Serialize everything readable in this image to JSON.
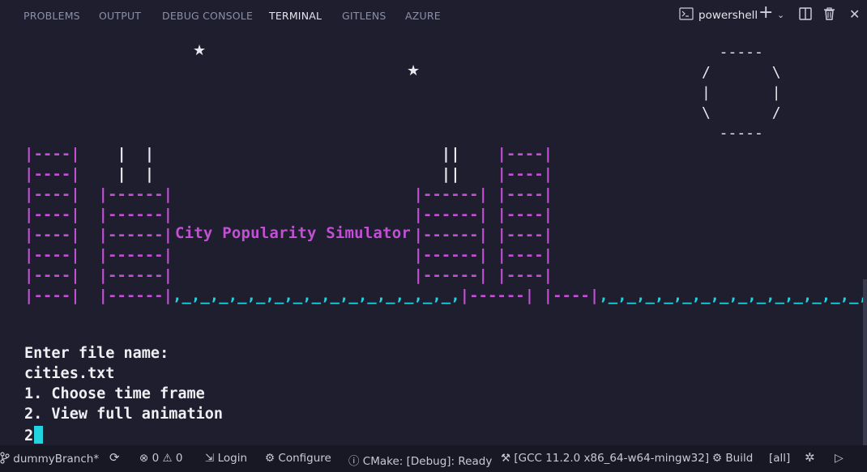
{
  "panel": {
    "tabs": [
      {
        "label": "PROBLEMS"
      },
      {
        "label": "OUTPUT"
      },
      {
        "label": "DEBUG CONSOLE"
      },
      {
        "label": "TERMINAL"
      },
      {
        "label": "GITLENS"
      },
      {
        "label": "AZURE"
      }
    ],
    "active_tab": "TERMINAL",
    "shell_label": "powershell"
  },
  "terminal": {
    "title_text": "City Popularity Simulator",
    "output_lines": [
      "Enter file name:",
      "cities.txt",
      "1. Choose time frame",
      "2. View full animation"
    ],
    "input_line": "2"
  },
  "statusbar": {
    "branch": "dummyBranch*",
    "errors": "0",
    "warnings": "0",
    "login": "Login",
    "configure": "Configure",
    "cmake": "CMake: [Debug]: Ready",
    "kit": "[GCC 11.2.0 x86_64-w64-mingw32]",
    "build": "Build",
    "target": "[all]"
  },
  "colors": {
    "background": "#1e1e2e",
    "building": "#c24fd4",
    "water": "#22d3e0",
    "cursor": "#22d3e0"
  }
}
